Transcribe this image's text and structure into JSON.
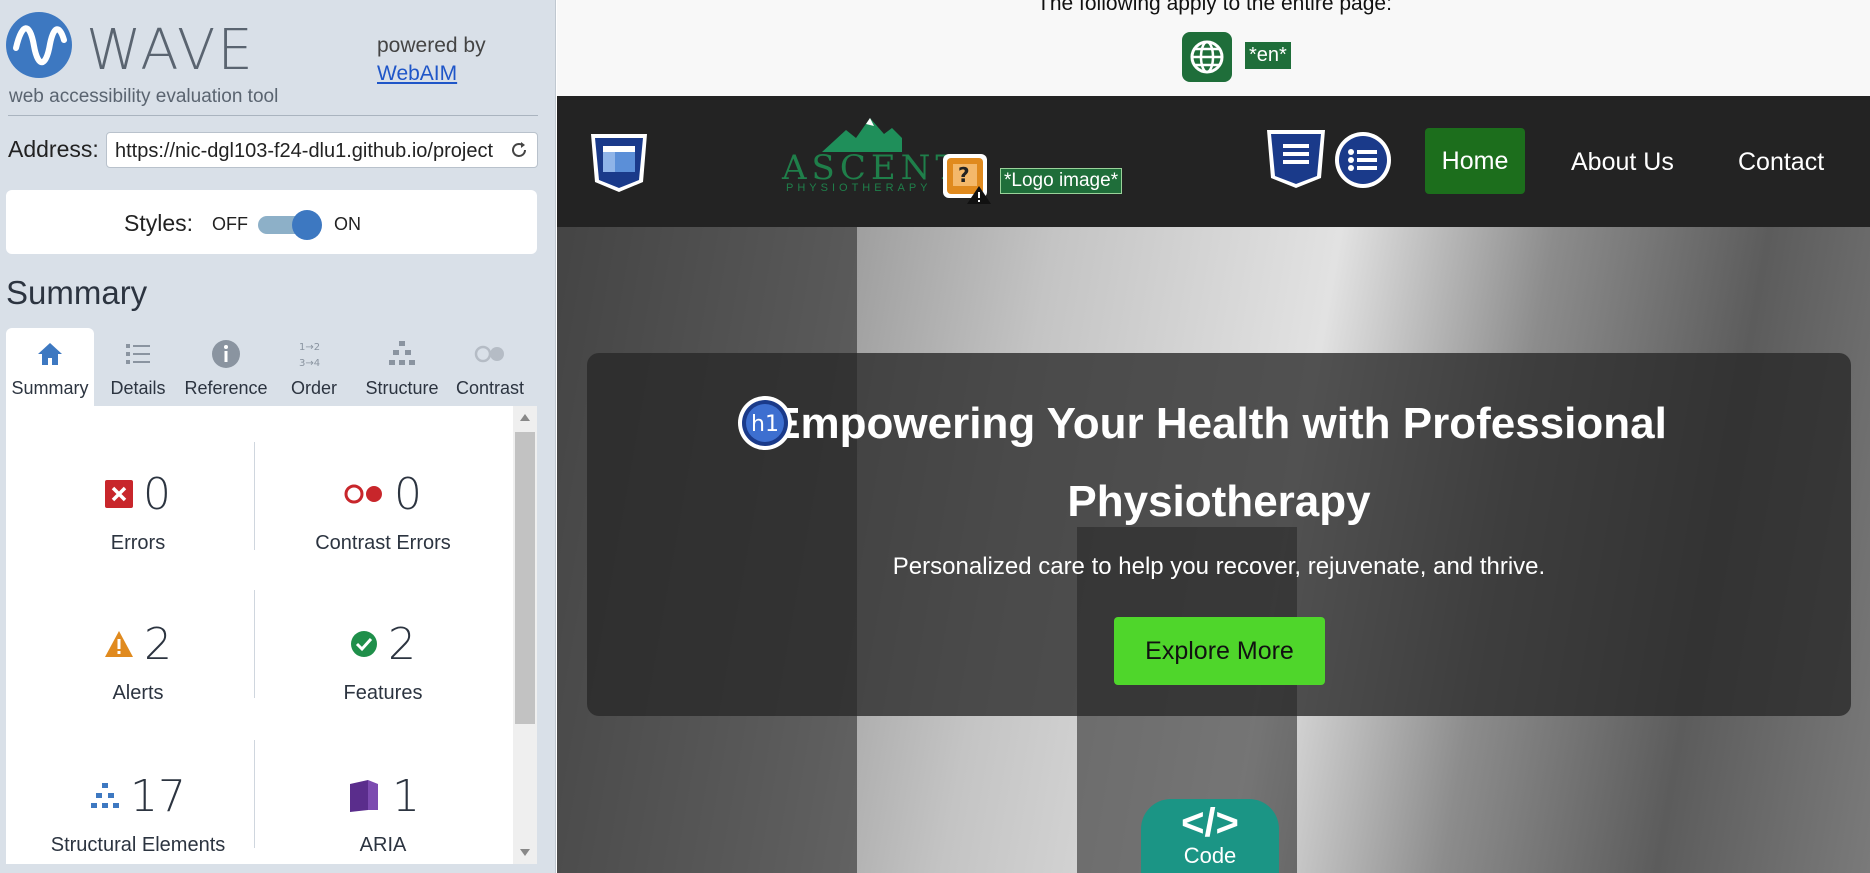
{
  "sidebar": {
    "brand": {
      "name": "WAVE",
      "tagline": "web accessibility evaluation tool",
      "powered_by": "powered by",
      "powered_link": "WebAIM"
    },
    "address": {
      "label": "Address:",
      "value": "https://nic-dgl103-f24-dlu1.github.io/project"
    },
    "styles": {
      "label": "Styles:",
      "off": "OFF",
      "on": "ON"
    },
    "summary_title": "Summary",
    "tabs": [
      {
        "label": "Summary",
        "icon": "home-icon"
      },
      {
        "label": "Details",
        "icon": "list-icon"
      },
      {
        "label": "Reference",
        "icon": "info-icon"
      },
      {
        "label": "Order",
        "icon": "order-icon"
      },
      {
        "label": "Structure",
        "icon": "structure-icon"
      },
      {
        "label": "Contrast",
        "icon": "contrast-icon"
      }
    ],
    "stats": {
      "errors": {
        "value": "0",
        "label": "Errors"
      },
      "contrast_errors": {
        "value": "0",
        "label": "Contrast Errors"
      },
      "alerts": {
        "value": "2",
        "label": "Alerts"
      },
      "features": {
        "value": "2",
        "label": "Features"
      },
      "structural": {
        "value": "17",
        "label": "Structural Elements"
      },
      "aria": {
        "value": "1",
        "label": "ARIA"
      }
    }
  },
  "page": {
    "strip_text": "The following apply to the entire page:",
    "lang_tag": "*en*",
    "nav": {
      "logo_word": "ASCENT",
      "logo_sub": "PHYSIOTHERAPY",
      "logo_tag": "*Logo image*",
      "items": [
        "Home",
        "About Us",
        "Contact"
      ]
    },
    "hero": {
      "title": "Empowering Your Health with Professional Physiotherapy",
      "subtitle": "Personalized care to help you recover, rejuvenate, and thrive.",
      "button": "Explore More",
      "h1_badge": "h1"
    },
    "code_badge": {
      "glyph": "</>",
      "label": "Code"
    }
  },
  "colors": {
    "wave_blue": "#3d78c1",
    "wave_green": "#1f6e3a",
    "cta_green": "#4fd62b",
    "nav_bg": "#232323"
  }
}
